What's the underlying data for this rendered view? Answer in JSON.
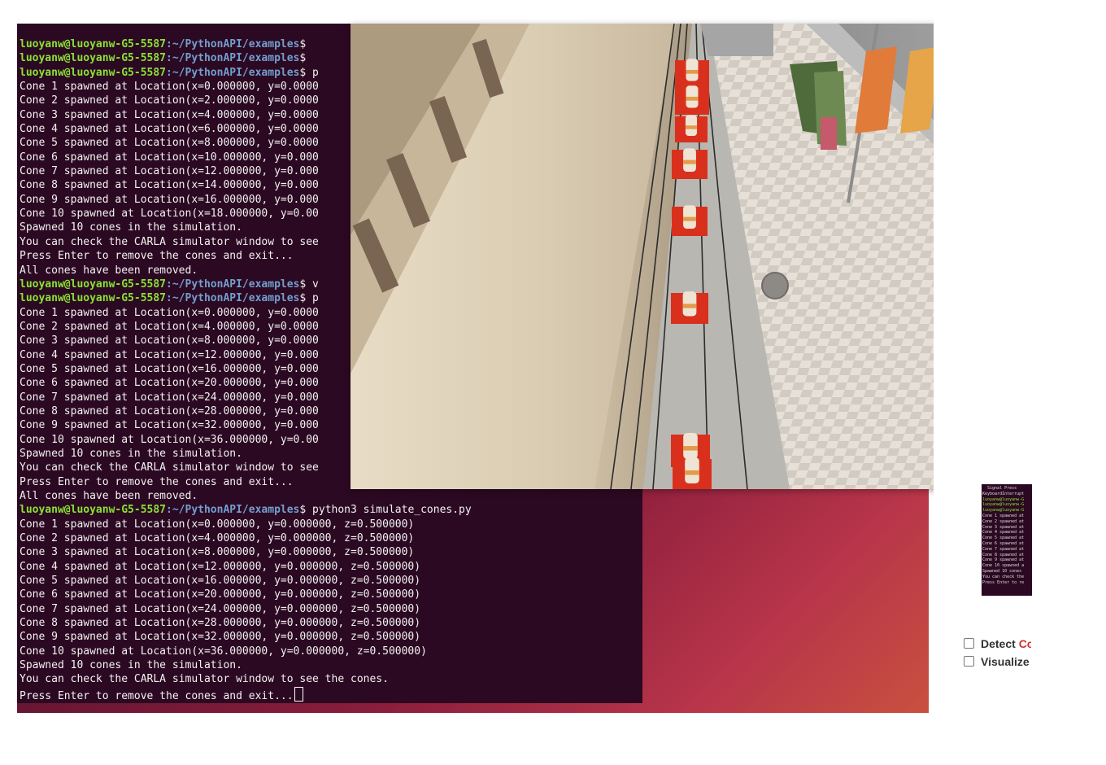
{
  "terminal": {
    "prompt_user": "luoyanw@luoyanw-G5-5587",
    "prompt_path": ":~/PythonAPI/examples",
    "lines": [
      {
        "user": true,
        "text": "$ "
      },
      {
        "user": true,
        "text": "$ "
      },
      {
        "user": true,
        "text": "$ p"
      },
      {
        "text": "Cone 1 spawned at Location(x=0.000000, y=0.0000"
      },
      {
        "text": "Cone 2 spawned at Location(x=2.000000, y=0.0000"
      },
      {
        "text": "Cone 3 spawned at Location(x=4.000000, y=0.0000"
      },
      {
        "text": "Cone 4 spawned at Location(x=6.000000, y=0.0000"
      },
      {
        "text": "Cone 5 spawned at Location(x=8.000000, y=0.0000"
      },
      {
        "text": "Cone 6 spawned at Location(x=10.000000, y=0.000"
      },
      {
        "text": "Cone 7 spawned at Location(x=12.000000, y=0.000"
      },
      {
        "text": "Cone 8 spawned at Location(x=14.000000, y=0.000"
      },
      {
        "text": "Cone 9 spawned at Location(x=16.000000, y=0.000"
      },
      {
        "text": "Cone 10 spawned at Location(x=18.000000, y=0.00"
      },
      {
        "text": "Spawned 10 cones in the simulation."
      },
      {
        "text": "You can check the CARLA simulator window to see"
      },
      {
        "text": "Press Enter to remove the cones and exit..."
      },
      {
        "text": "All cones have been removed."
      },
      {
        "user": true,
        "text": "$ v"
      },
      {
        "user": true,
        "text": "$ p"
      },
      {
        "text": "Cone 1 spawned at Location(x=0.000000, y=0.0000"
      },
      {
        "text": "Cone 2 spawned at Location(x=4.000000, y=0.0000"
      },
      {
        "text": "Cone 3 spawned at Location(x=8.000000, y=0.0000"
      },
      {
        "text": "Cone 4 spawned at Location(x=12.000000, y=0.000"
      },
      {
        "text": "Cone 5 spawned at Location(x=16.000000, y=0.000"
      },
      {
        "text": "Cone 6 spawned at Location(x=20.000000, y=0.000"
      },
      {
        "text": "Cone 7 spawned at Location(x=24.000000, y=0.000"
      },
      {
        "text": "Cone 8 spawned at Location(x=28.000000, y=0.000"
      },
      {
        "text": "Cone 9 spawned at Location(x=32.000000, y=0.000"
      },
      {
        "text": "Cone 10 spawned at Location(x=36.000000, y=0.00"
      },
      {
        "text": "Spawned 10 cones in the simulation."
      },
      {
        "text": "You can check the CARLA simulator window to see"
      },
      {
        "text": "Press Enter to remove the cones and exit..."
      },
      {
        "text": "All cones have been removed."
      },
      {
        "user": true,
        "text": "$ python3 simulate_cones.py"
      },
      {
        "text": "Cone 1 spawned at Location(x=0.000000, y=0.000000, z=0.500000)"
      },
      {
        "text": "Cone 2 spawned at Location(x=4.000000, y=0.000000, z=0.500000)"
      },
      {
        "text": "Cone 3 spawned at Location(x=8.000000, y=0.000000, z=0.500000)"
      },
      {
        "text": "Cone 4 spawned at Location(x=12.000000, y=0.000000, z=0.500000)"
      },
      {
        "text": "Cone 5 spawned at Location(x=16.000000, y=0.000000, z=0.500000)"
      },
      {
        "text": "Cone 6 spawned at Location(x=20.000000, y=0.000000, z=0.500000)"
      },
      {
        "text": "Cone 7 spawned at Location(x=24.000000, y=0.000000, z=0.500000)"
      },
      {
        "text": "Cone 8 spawned at Location(x=28.000000, y=0.000000, z=0.500000)"
      },
      {
        "text": "Cone 9 spawned at Location(x=32.000000, y=0.000000, z=0.500000)"
      },
      {
        "text": "Cone 10 spawned at Location(x=36.000000, y=0.000000, z=0.500000)"
      },
      {
        "text": "Spawned 10 cones in the simulation."
      },
      {
        "text": "You can check the CARLA simulator window to see the cones."
      },
      {
        "text": "Press Enter to remove the cones and exit...",
        "cursor": true
      }
    ]
  },
  "mini_terminal": {
    "lines": [
      {
        "text": "  Signal Press",
        "green": false
      },
      {
        "text": "KeyboardInterrupt",
        "green": false
      },
      {
        "text": "luoyanw@luoyanw-G",
        "green": true
      },
      {
        "text": "luoyanw@luoyanw-G",
        "green": true
      },
      {
        "text": "luoyanw@luoyanw-G",
        "green": true
      },
      {
        "text": "Cone 1 spawned at",
        "green": false
      },
      {
        "text": "Cone 2 spawned at",
        "green": false
      },
      {
        "text": "Cone 3 spawned at",
        "green": false
      },
      {
        "text": "Cone 4 spawned at",
        "green": false
      },
      {
        "text": "Cone 5 spawned at",
        "green": false
      },
      {
        "text": "Cone 6 spawned at",
        "green": false
      },
      {
        "text": "Cone 7 spawned at",
        "green": false
      },
      {
        "text": "Cone 8 spawned at",
        "green": false
      },
      {
        "text": "Cone 9 spawned at",
        "green": false
      },
      {
        "text": "Cone 10 spawned a",
        "green": false
      },
      {
        "text": "Spawned 10 cones",
        "green": false
      },
      {
        "text": "You can check the",
        "green": false
      },
      {
        "text": "Press Enter to re",
        "green": false
      }
    ]
  },
  "options": {
    "detect": {
      "label": "Detect ",
      "accent": "Co"
    },
    "visualize": {
      "label": "Visualize"
    }
  },
  "colors": {
    "terminal_bg": "#2c0922",
    "prompt_green": "#8ae234",
    "prompt_blue": "#729fcf",
    "cone_marker_red": "#d9301e"
  },
  "simulator": {
    "cone_count": 8
  }
}
